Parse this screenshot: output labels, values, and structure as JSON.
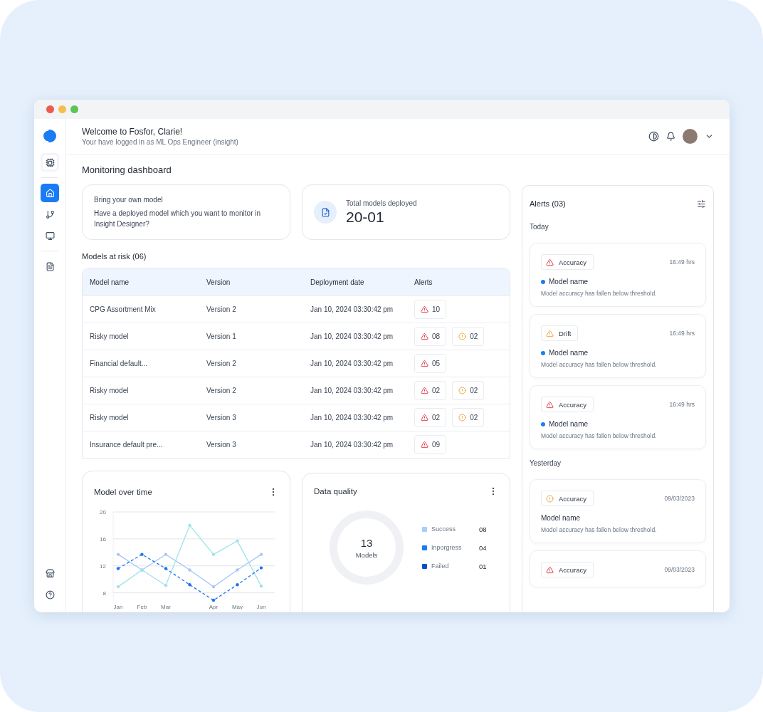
{
  "header": {
    "title": "Welcome to Fosfor, Clarie!",
    "subtitle": "Your have logged in as ML Ops Engineer (insight)"
  },
  "sidebar": {
    "groups": [
      [
        {
          "kind": "chip",
          "selected": false
        }
      ],
      [
        {
          "kind": "home",
          "selected": true
        },
        {
          "kind": "branch",
          "selected": false
        },
        {
          "kind": "monitor",
          "selected": false
        }
      ],
      [
        {
          "kind": "document",
          "selected": false
        }
      ]
    ],
    "bottom_items": [
      {
        "kind": "store",
        "selected": false
      },
      {
        "kind": "help",
        "selected": false
      }
    ]
  },
  "page_title": "Monitoring dashboard",
  "byom_card": {
    "title": "Bring your own model",
    "text": "Have a deployed model which you want to monitor in Insight Designer?"
  },
  "total_card": {
    "label": "Total models deployed",
    "value": "20-01"
  },
  "models_at_risk": {
    "title": "Models at risk (06)",
    "columns": [
      "Model name",
      "Version",
      "Deployment date",
      "Alerts"
    ],
    "rows": [
      {
        "cells": [
          "CPG Assortment Mix",
          "Version 2",
          "Jan 10, 2024 03:30:42 pm"
        ],
        "alerts": [
          {
            "kind": "critical",
            "count": "10"
          }
        ]
      },
      {
        "cells": [
          "Risky model",
          "Version 1",
          "Jan 10, 2024 03:30:42 pm"
        ],
        "alerts": [
          {
            "kind": "critical",
            "count": "08"
          },
          {
            "kind": "warning",
            "count": "02"
          }
        ]
      },
      {
        "cells": [
          "Financial default...",
          "Version 2",
          "Jan 10, 2024 03:30:42 pm"
        ],
        "alerts": [
          {
            "kind": "critical",
            "count": "05"
          }
        ]
      },
      {
        "cells": [
          "Risky model",
          "Version 2",
          "Jan 10, 2024 03:30:42 pm"
        ],
        "alerts": [
          {
            "kind": "critical",
            "count": "02"
          },
          {
            "kind": "warning",
            "count": "02"
          }
        ]
      },
      {
        "cells": [
          "Risky model",
          "Version 3",
          "Jan 10, 2024 03:30:42 pm"
        ],
        "alerts": [
          {
            "kind": "critical",
            "count": "02"
          },
          {
            "kind": "warning",
            "count": "02"
          }
        ]
      },
      {
        "cells": [
          "Insurance default pre...",
          "Version 3",
          "Jan 10, 2024 03:30:42 pm"
        ],
        "alerts": [
          {
            "kind": "critical",
            "count": "09"
          }
        ]
      }
    ]
  },
  "model_over_time": {
    "title": "Model over time",
    "chart_data": {
      "type": "line",
      "categories": [
        "Jan",
        "Feb",
        "Mar",
        null,
        "Apr",
        "May",
        "Jun"
      ],
      "yticks": [
        8,
        12,
        16,
        20
      ],
      "ylim": [
        6.8,
        20
      ],
      "grid": true,
      "series": [
        {
          "color": "#a9c6f6",
          "values": [
            13.7,
            11.4,
            13.7,
            11.4,
            8.9,
            11.4,
            13.7
          ]
        },
        {
          "color": "#9fe2ea",
          "values": [
            8.9,
            11.4,
            9.1,
            18,
            13.7,
            15.7,
            9
          ]
        },
        {
          "color": "#1a73f0",
          "line_style": "dashed",
          "values": [
            11.6,
            13.7,
            11.6,
            9.2,
            6.9,
            9.2,
            11.7
          ]
        }
      ]
    }
  },
  "data_quality": {
    "title": "Data quality",
    "total": "13",
    "unit": "Models",
    "legend": [
      {
        "label": "Success",
        "value": "08",
        "color": "#a9cdf9"
      },
      {
        "label": "Inporgress",
        "value": "04",
        "color": "#1a7cf5"
      },
      {
        "label": "Failed",
        "value": "01",
        "color": "#0a4fc4"
      }
    ]
  },
  "alerts": {
    "title": "Alerts (03)",
    "groups": [
      {
        "label": "Today",
        "items": [
          {
            "kind": "critical",
            "tag": "Accuracy",
            "time": "16:49 hrs",
            "model": "Model name",
            "unread": true,
            "message": "Model accuracy has fallen below threshold."
          },
          {
            "kind": "drift",
            "tag": "Drift",
            "time": "16:49 hrs",
            "model": "Model name",
            "unread": true,
            "message": "Model accuracy has fallen below threshold."
          },
          {
            "kind": "critical",
            "tag": "Accuracy",
            "time": "16:49 hrs",
            "model": "Model name",
            "unread": true,
            "message": "Model accuracy has fallen below threshold."
          }
        ]
      },
      {
        "label": "Yesterday",
        "items": [
          {
            "kind": "warning",
            "tag": "Accuracy",
            "time": "09/03/2023",
            "model": "Model name",
            "unread": false,
            "message": "Model accuracy has fallen below threshold."
          },
          {
            "kind": "critical",
            "tag": "Accuracy",
            "time": "09/03/2023"
          }
        ]
      }
    ]
  }
}
